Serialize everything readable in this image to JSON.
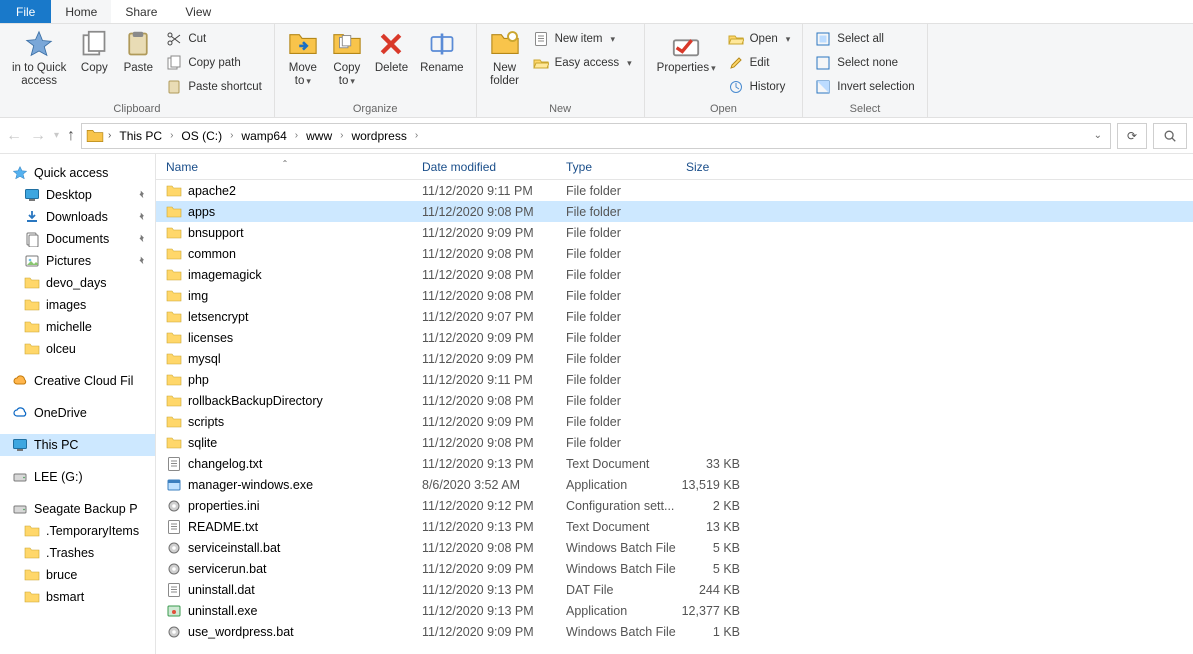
{
  "tabs": {
    "file": "File",
    "home": "Home",
    "share": "Share",
    "view": "View"
  },
  "ribbon": {
    "clipboard": {
      "label": "Clipboard",
      "pin": "in to Quick\naccess",
      "copy": "Copy",
      "paste": "Paste",
      "cut": "Cut",
      "copypath": "Copy path",
      "pasteshortcut": "Paste shortcut"
    },
    "organize": {
      "label": "Organize",
      "moveto": "Move\nto",
      "copyto": "Copy\nto",
      "delete": "Delete",
      "rename": "Rename"
    },
    "new": {
      "label": "New",
      "newfolder": "New\nfolder",
      "newitem": "New item",
      "easyaccess": "Easy access"
    },
    "open": {
      "label": "Open",
      "properties": "Properties",
      "open": "Open",
      "edit": "Edit",
      "history": "History"
    },
    "select": {
      "label": "Select",
      "selectall": "Select all",
      "selectnone": "Select none",
      "invert": "Invert selection"
    }
  },
  "breadcrumbs": [
    "This PC",
    "OS (C:)",
    "wamp64",
    "www",
    "wordpress"
  ],
  "columns": {
    "name": "Name",
    "date": "Date modified",
    "type": "Type",
    "size": "Size"
  },
  "nav": {
    "quickaccess": "Quick access",
    "pinned": [
      "Desktop",
      "Downloads",
      "Documents",
      "Pictures"
    ],
    "recent": [
      "devo_days",
      "images",
      "michelle",
      "olceu"
    ],
    "creativecloud": "Creative Cloud Fil",
    "onedrive": "OneDrive",
    "thispc": "This PC",
    "drives": [
      "LEE (G:)",
      "Seagate Backup P"
    ],
    "extras": [
      ".TemporaryItems",
      ".Trashes",
      "bruce",
      "bsmart"
    ]
  },
  "files": [
    {
      "icon": "folder",
      "name": "apache2",
      "date": "11/12/2020 9:11 PM",
      "type": "File folder",
      "size": ""
    },
    {
      "icon": "folder",
      "name": "apps",
      "date": "11/12/2020 9:08 PM",
      "type": "File folder",
      "size": "",
      "selected": true
    },
    {
      "icon": "folder",
      "name": "bnsupport",
      "date": "11/12/2020 9:09 PM",
      "type": "File folder",
      "size": ""
    },
    {
      "icon": "folder",
      "name": "common",
      "date": "11/12/2020 9:08 PM",
      "type": "File folder",
      "size": ""
    },
    {
      "icon": "folder",
      "name": "imagemagick",
      "date": "11/12/2020 9:08 PM",
      "type": "File folder",
      "size": ""
    },
    {
      "icon": "folder",
      "name": "img",
      "date": "11/12/2020 9:08 PM",
      "type": "File folder",
      "size": ""
    },
    {
      "icon": "folder",
      "name": "letsencrypt",
      "date": "11/12/2020 9:07 PM",
      "type": "File folder",
      "size": ""
    },
    {
      "icon": "folder",
      "name": "licenses",
      "date": "11/12/2020 9:09 PM",
      "type": "File folder",
      "size": ""
    },
    {
      "icon": "folder",
      "name": "mysql",
      "date": "11/12/2020 9:09 PM",
      "type": "File folder",
      "size": ""
    },
    {
      "icon": "folder",
      "name": "php",
      "date": "11/12/2020 9:11 PM",
      "type": "File folder",
      "size": ""
    },
    {
      "icon": "folder",
      "name": "rollbackBackupDirectory",
      "date": "11/12/2020 9:08 PM",
      "type": "File folder",
      "size": ""
    },
    {
      "icon": "folder",
      "name": "scripts",
      "date": "11/12/2020 9:09 PM",
      "type": "File folder",
      "size": ""
    },
    {
      "icon": "folder",
      "name": "sqlite",
      "date": "11/12/2020 9:08 PM",
      "type": "File folder",
      "size": ""
    },
    {
      "icon": "text",
      "name": "changelog.txt",
      "date": "11/12/2020 9:13 PM",
      "type": "Text Document",
      "size": "33 KB"
    },
    {
      "icon": "exe",
      "name": "manager-windows.exe",
      "date": "8/6/2020 3:52 AM",
      "type": "Application",
      "size": "13,519 KB"
    },
    {
      "icon": "ini",
      "name": "properties.ini",
      "date": "11/12/2020 9:12 PM",
      "type": "Configuration sett...",
      "size": "2 KB"
    },
    {
      "icon": "text",
      "name": "README.txt",
      "date": "11/12/2020 9:13 PM",
      "type": "Text Document",
      "size": "13 KB"
    },
    {
      "icon": "bat",
      "name": "serviceinstall.bat",
      "date": "11/12/2020 9:08 PM",
      "type": "Windows Batch File",
      "size": "5 KB"
    },
    {
      "icon": "bat",
      "name": "servicerun.bat",
      "date": "11/12/2020 9:09 PM",
      "type": "Windows Batch File",
      "size": "5 KB"
    },
    {
      "icon": "dat",
      "name": "uninstall.dat",
      "date": "11/12/2020 9:13 PM",
      "type": "DAT File",
      "size": "244 KB"
    },
    {
      "icon": "exe2",
      "name": "uninstall.exe",
      "date": "11/12/2020 9:13 PM",
      "type": "Application",
      "size": "12,377 KB"
    },
    {
      "icon": "bat",
      "name": "use_wordpress.bat",
      "date": "11/12/2020 9:09 PM",
      "type": "Windows Batch File",
      "size": "1 KB"
    }
  ]
}
